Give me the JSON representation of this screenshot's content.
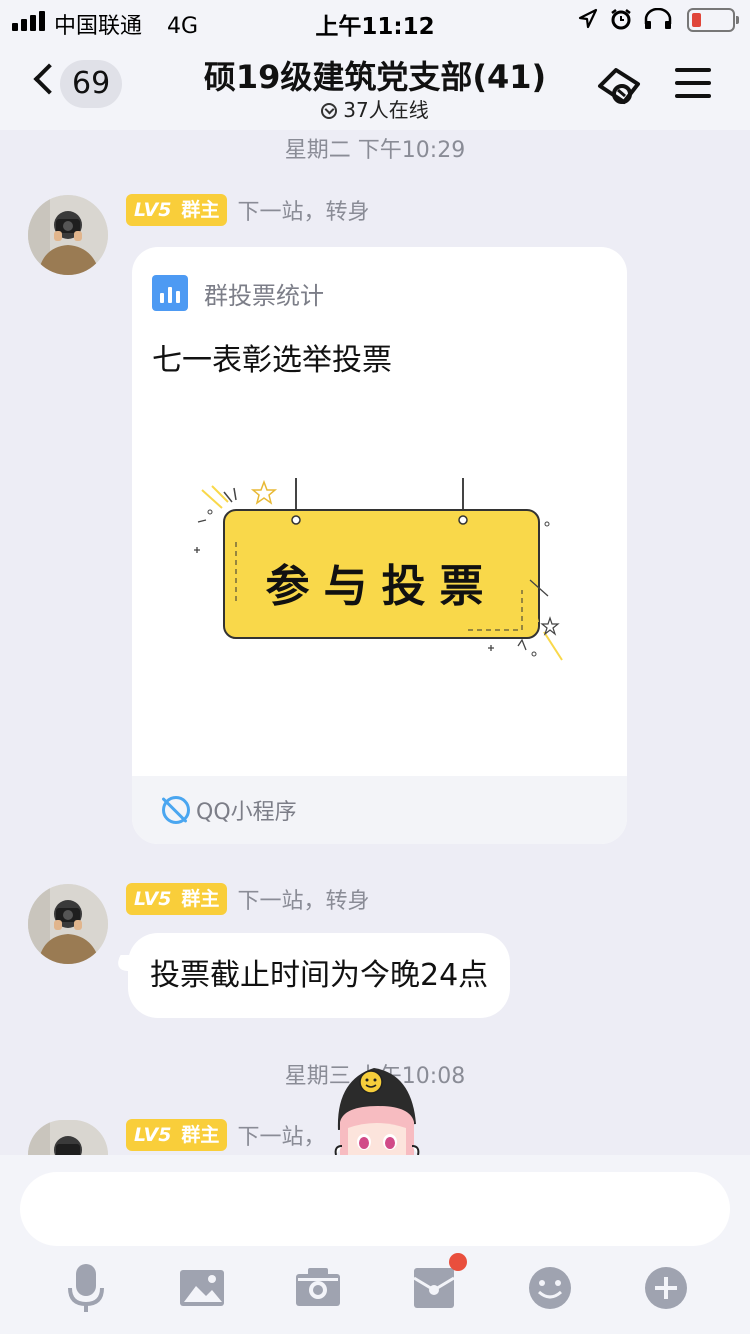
{
  "status_bar": {
    "carrier": "中国联通",
    "network": "4G",
    "time": "上午11:12",
    "icons": [
      "location-icon",
      "alarm-icon",
      "headphones-icon",
      "battery-icon"
    ],
    "battery_level": 0.15
  },
  "nav": {
    "back_count": "69",
    "title": "硕19级建筑党支部(41)",
    "online": "37人在线",
    "icons": [
      "back-chevron-icon",
      "ticket-icon",
      "menu-icon"
    ]
  },
  "messages": {
    "ts1": "星期二 下午10:29",
    "ts2": "星期三 上午10:08",
    "sender": {
      "level": "LV5",
      "role": "群主",
      "name": "下一站，转身"
    },
    "sender_partial": "下一站，",
    "card": {
      "header_label": "群投票统计",
      "title": "七一表彰选举投票",
      "sign_text": "参与投票",
      "footer_label": "QQ小程序"
    },
    "text_message": "投票截止时间为今晚24点"
  },
  "toolbar": {
    "items": [
      "microphone-icon",
      "image-icon",
      "camera-icon",
      "red-packet-icon",
      "emoji-icon",
      "plus-icon"
    ]
  },
  "colors": {
    "accent_blue": "#4D9AF3",
    "badge_yellow": "#F9CE3A",
    "sign_yellow": "#F9D84A",
    "notif_red": "#E94F3D",
    "background": "#EDEDF5"
  }
}
